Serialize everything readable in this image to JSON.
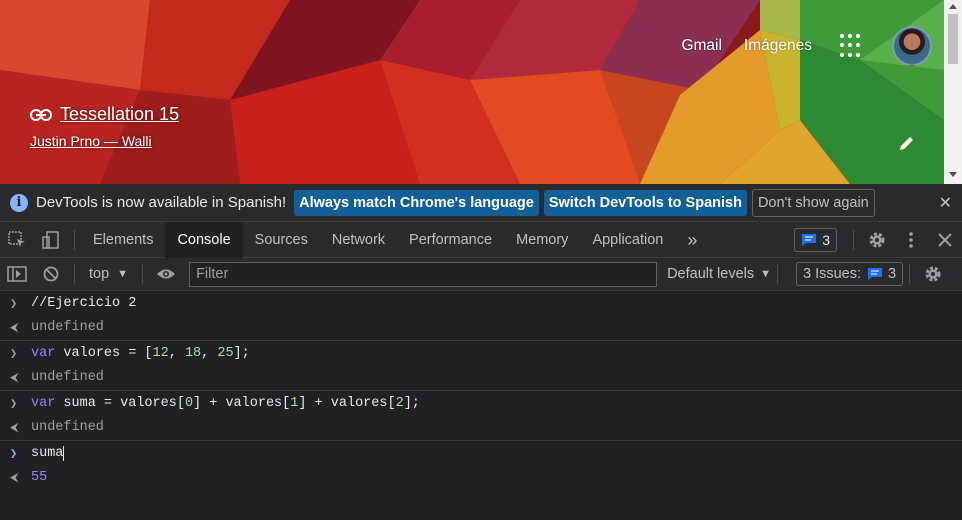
{
  "page": {
    "nav": {
      "gmail": "Gmail",
      "images": "Imágenes"
    },
    "attribution": {
      "title": "Tessellation 15",
      "author": "Justin Prno — Walli"
    }
  },
  "infobar": {
    "message": "DevTools is now available in Spanish!",
    "btn_match": "Always match Chrome's language",
    "btn_switch": "Switch DevTools to Spanish",
    "btn_dismiss": "Don't show again",
    "close": "✕"
  },
  "tabs": {
    "items": [
      "Elements",
      "Console",
      "Sources",
      "Network",
      "Performance",
      "Memory",
      "Application"
    ],
    "active": "Console",
    "more": "»",
    "issues_count": "3"
  },
  "console_toolbar": {
    "context": "top",
    "filter_placeholder": "Filter",
    "levels": "Default levels",
    "issues_label": "3 Issues:",
    "issues_count": "3"
  },
  "console": {
    "entries": [
      {
        "input": "//Ejercicio 2",
        "output": "undefined"
      },
      {
        "input_kw": "var",
        "input_rest_a": " valores = [",
        "n1": "12",
        "c1": ", ",
        "n2": "18",
        "c2": ", ",
        "n3": "25",
        "input_rest_b": "];",
        "output": "undefined"
      },
      {
        "input_kw": "var",
        "input_rest": " suma = valores[",
        "i0": "0",
        "p1": "] + valores[",
        "i1": "1",
        "p2": "] + valores[",
        "i2": "2",
        "p3": "];",
        "output": "undefined"
      },
      {
        "input": "suma",
        "output": "55"
      }
    ]
  },
  "colors": {
    "accent": "#8ab4f8",
    "keyword": "#9980ff",
    "bg": "#202124",
    "toolbar": "#292a2d"
  }
}
